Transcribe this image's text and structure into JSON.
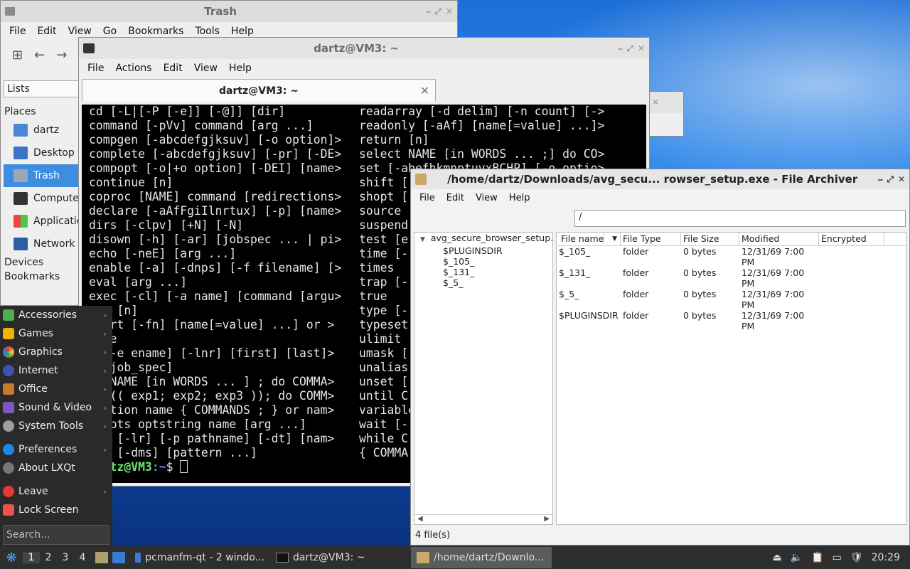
{
  "file_manager": {
    "title": "Trash",
    "menu": [
      "File",
      "Edit",
      "View",
      "Go",
      "Bookmarks",
      "Tools",
      "Help"
    ],
    "side_header": "Lists",
    "places_label": "Places",
    "places": [
      "dartz",
      "Desktop",
      "Trash",
      "Compute",
      "Applicatio",
      "Network"
    ],
    "devices_label": "Devices",
    "bookmarks_label": "Bookmarks"
  },
  "terminal": {
    "title": "dartz@VM3: ~",
    "menu": [
      "File",
      "Actions",
      "Edit",
      "View",
      "Help"
    ],
    "tab_label": "dartz@VM3: ~",
    "left": [
      "cd [-L|[-P [-e]] [-@]] [dir]",
      "command [-pVv] command [arg ...]",
      "compgen [-abcdefgjksuv] [-o option]>",
      "complete [-abcdefgjksuv] [-pr] [-DE>",
      "compopt [-o|+o option] [-DEI] [name>",
      "continue [n]",
      "coproc [NAME] command [redirections>",
      "declare [-aAfFgiIlnrtux] [-p] [name>",
      "dirs [-clpv] [+N] [-N]",
      "disown [-h] [-ar] [jobspec ... | pi>",
      "echo [-neE] [arg ...]",
      "enable [-a] [-dnps] [-f filename] [>",
      "eval [arg ...]",
      "exec [-cl] [-a name] [command [argu>",
      "  t [n]",
      "  ort [-fn] [name[=value] ...] or >",
      "  se",
      "  [-e ename] [-lnr] [first] [last]>",
      "  [job_spec]",
      "   NAME [in WORDS ... ] ; do COMMA>",
      "   (( exp1; exp2; exp3 )); do COMM>",
      "  ction name { COMMANDS ; } or nam>",
      "  opts optstring name [arg ...]",
      "  n [-lr] [-p pathname] [-dt] [nam>",
      "  p [-dms] [pattern ...]"
    ],
    "right": [
      "readarray [-d delim] [-n count] [->",
      "readonly [-aAf] [name[=value] ...]>",
      "return [n]",
      "select NAME [in WORDS ... ;] do CO>",
      "set [-abefhkmnptuvxBCHP] [-o optio>",
      "shift [",
      "shopt [",
      "source",
      "suspend",
      "test [e",
      "time [-",
      "times",
      "trap [-",
      "true",
      "type [-",
      "typeset",
      "ulimit",
      "umask [",
      "unalias",
      "unset [",
      "until C",
      "variable",
      "wait [-",
      "while C",
      "{ COMMA"
    ],
    "prompt_user": "dartz@VM3",
    "prompt_path": ":~",
    "prompt_symbol": "$"
  },
  "archiver": {
    "title": "/home/dartz/Downloads/avg_secu... rowser_setup.exe - File Archiver",
    "menu": [
      "File",
      "Edit",
      "View",
      "Help"
    ],
    "path": "/",
    "tree_root": "avg_secure_browser_setup.exe",
    "tree_nodes": [
      "$PLUGINSDIR",
      "$_105_",
      "$_131_",
      "$_5_"
    ],
    "columns": [
      "File name",
      "File Type",
      "File Size",
      "Modified",
      "Encrypted"
    ],
    "rows": [
      [
        "$_105_",
        "folder",
        "0 bytes",
        "12/31/69 7:00 PM",
        ""
      ],
      [
        "$_131_",
        "folder",
        "0 bytes",
        "12/31/69 7:00 PM",
        ""
      ],
      [
        "$_5_",
        "folder",
        "0 bytes",
        "12/31/69 7:00 PM",
        ""
      ],
      [
        "$PLUGINSDIR",
        "folder",
        "0 bytes",
        "12/31/69 7:00 PM",
        ""
      ]
    ],
    "status": "4 file(s)"
  },
  "start_menu": {
    "items": [
      "Accessories",
      "Games",
      "Graphics",
      "Internet",
      "Office",
      "Sound & Video",
      "System Tools"
    ],
    "items2": [
      "Preferences",
      "About LXQt"
    ],
    "items3": [
      "Leave",
      "Lock Screen"
    ],
    "search_placeholder": "Search..."
  },
  "taskbar": {
    "workspaces": [
      "1",
      "2",
      "3",
      "4"
    ],
    "tasks": [
      "pcmanfm-qt - 2 windo...",
      "dartz@VM3: ~",
      "/home/dartz/Downlo..."
    ],
    "clock": "20:29"
  }
}
